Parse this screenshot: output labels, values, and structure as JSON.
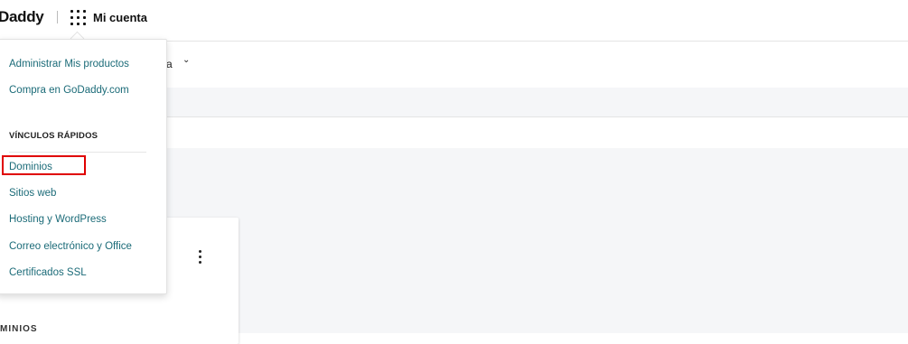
{
  "header": {
    "logo_text": "Daddy",
    "account_label": "Mi cuenta"
  },
  "subnav": {
    "partial_text": "nta"
  },
  "card": {
    "section_label": "MINIOS"
  },
  "dropdown": {
    "links": [
      "Administrar Mis productos",
      "Compra en GoDaddy.com"
    ],
    "quick_links_heading": "VÍNCULOS RÁPIDOS",
    "quick_links": [
      "Dominios",
      "Sitios web",
      "Hosting y WordPress",
      "Correo electrónico y Office",
      "Certificados SSL"
    ]
  },
  "colors": {
    "link": "#1b6b78",
    "highlight": "#e00000",
    "background": "#f5f6f8"
  }
}
